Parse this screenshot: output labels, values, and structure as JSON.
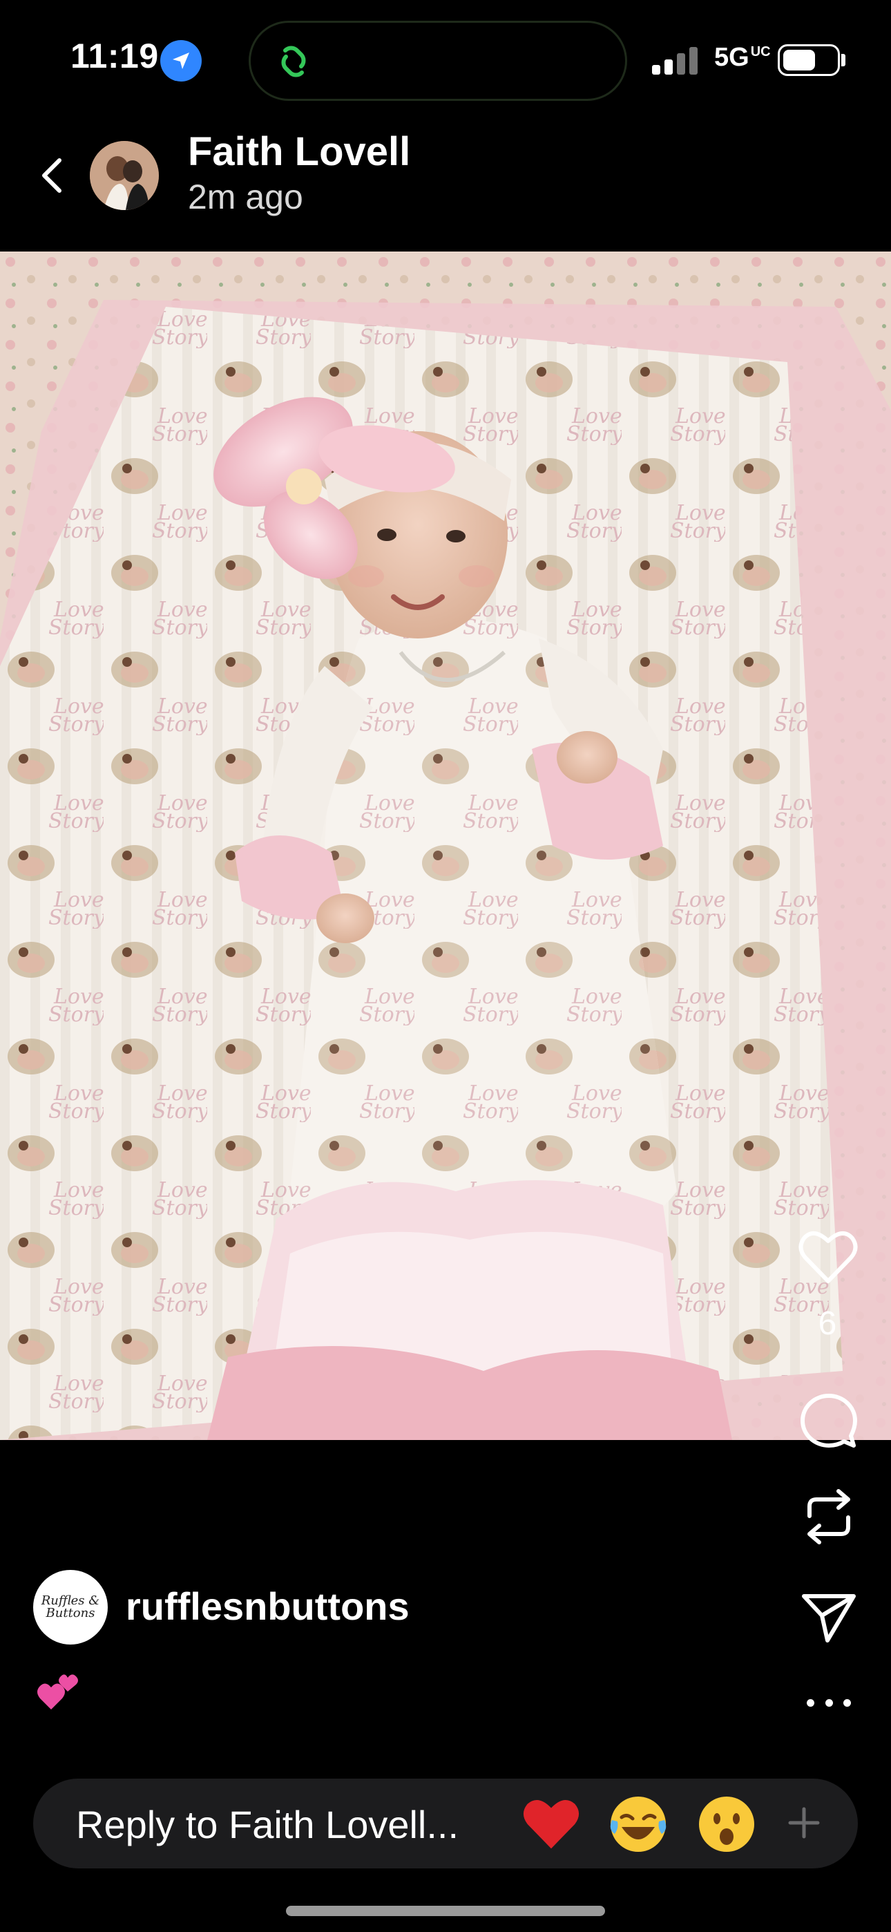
{
  "status_bar": {
    "time": "11:19",
    "network": "5G",
    "network_suffix": "UC",
    "icons": [
      "location-arrow-icon",
      "app-link-icon",
      "signal-icon",
      "battery-icon"
    ]
  },
  "header": {
    "user_name": "Faith Lovell",
    "post_age": "2m ago",
    "back_icon": "chevron-left-icon"
  },
  "story": {
    "print_text": "Love Story",
    "colors": {
      "blanket": "#f3ece6",
      "pink": "#f2c6cf",
      "floral_background": "#e7d4c8"
    }
  },
  "actions": {
    "like_count": "6",
    "icons": [
      "heart-icon",
      "comment-icon",
      "repost-icon",
      "send-icon",
      "more-icon"
    ]
  },
  "caption": {
    "brand_name": "rufflesnbuttons",
    "brand_avatar_text": "Ruffles & Buttons",
    "emoji": "💕"
  },
  "reply": {
    "placeholder": "Reply to Faith Lovell...",
    "reactions": [
      "❤️",
      "😂",
      "😮"
    ],
    "plus_icon": "plus-icon"
  }
}
